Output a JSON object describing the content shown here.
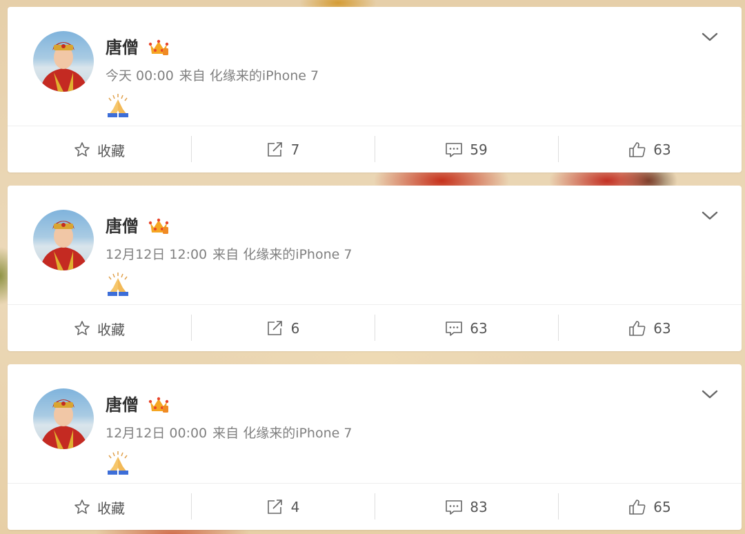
{
  "posts": [
    {
      "username": "唐僧",
      "time": "今天 00:00",
      "source": "来自 化缘来的iPhone 7",
      "content_emoji": "pray-icon",
      "favorite_label": "收藏",
      "repost_count": "7",
      "comment_count": "59",
      "like_count": "63"
    },
    {
      "username": "唐僧",
      "time": "12月12日 12:00",
      "source": "来自 化缘来的iPhone 7",
      "content_emoji": "pray-icon",
      "favorite_label": "收藏",
      "repost_count": "6",
      "comment_count": "63",
      "like_count": "63"
    },
    {
      "username": "唐僧",
      "time": "12月12日 00:00",
      "source": "来自 化缘来的iPhone 7",
      "content_emoji": "pray-icon",
      "favorite_label": "收藏",
      "repost_count": "4",
      "comment_count": "83",
      "like_count": "65"
    }
  ],
  "colors": {
    "username": "#333333",
    "meta": "#808080",
    "action_text": "#555555",
    "crown": "#f5a623"
  }
}
